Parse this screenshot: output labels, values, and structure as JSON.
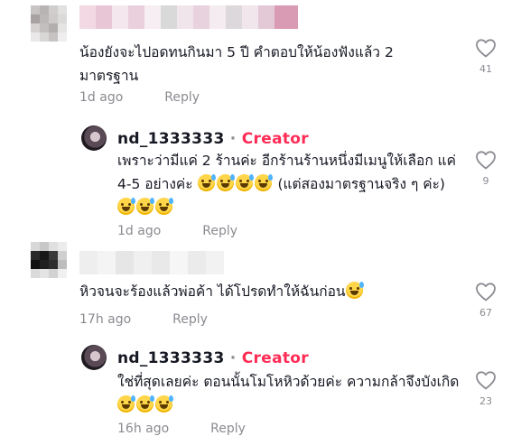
{
  "comments": [
    {
      "text": "น้องยังจะไปอดทนกินมา 5 ปี คำตอบให้น้องฟังแล้ว 2 มาตรฐาน",
      "time": "1d ago",
      "reply_label": "Reply",
      "likes": "41"
    },
    {
      "username": "nd_1333333",
      "separator": "·",
      "badge": "Creator",
      "text": "เพราะว่ามีแค่ 2 ร้านค่ะ อีกร้านร้านหนึ่งมีเมนูให้เลือก แค่ 4-5 อย่างค่ะ",
      "text_tail": " (แต่สองมาตรฐานจริง ๆ ค่ะ)",
      "time": "1d ago",
      "reply_label": "Reply",
      "likes": "9"
    },
    {
      "text": "หิวจนจะร้องแล้วพ่อค้า  ได้โปรดทำให้ฉันก่อน",
      "time": "17h ago",
      "reply_label": "Reply",
      "likes": "67"
    },
    {
      "username": "nd_1333333",
      "separator": "·",
      "badge": "Creator",
      "text": "ใช่ที่สุดเลยค่ะ ตอนนั้นโมโหหิวด้วยค่ะ ความกล้าจึงบังเกิด",
      "time": "16h ago",
      "reply_label": "Reply",
      "likes": "23"
    }
  ],
  "colors": {
    "creator_badge": "#fe2c55",
    "meta_text": "#8a8b91",
    "body_text": "#161823"
  },
  "icons": {
    "like": "heart-outline-icon",
    "emoji": "grinning-sweat-emoji"
  }
}
